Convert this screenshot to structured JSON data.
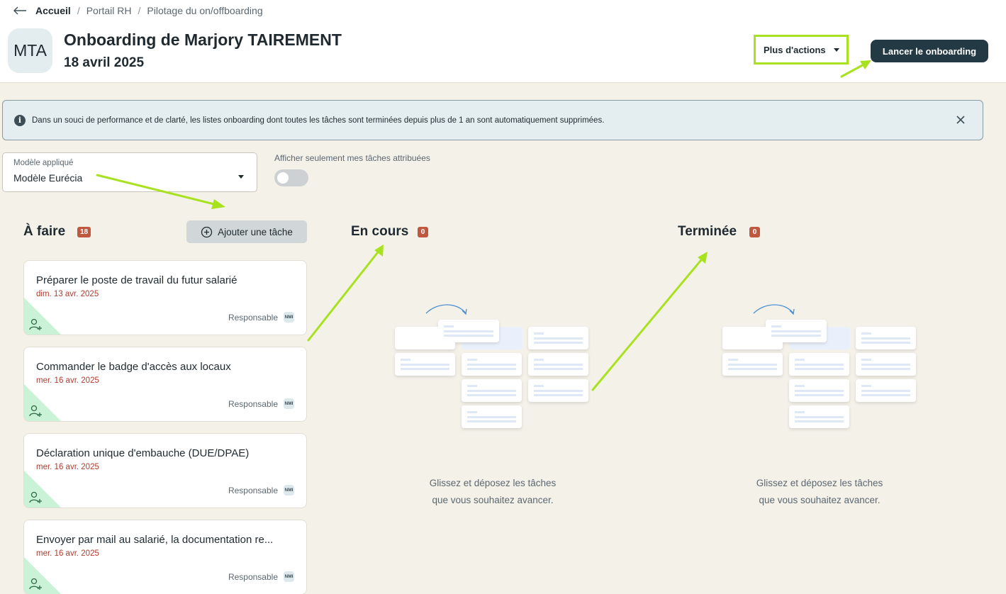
{
  "breadcrumb": {
    "items": [
      "Accueil",
      "Portail RH",
      "Pilotage du on/offboarding"
    ]
  },
  "header": {
    "avatar_initials": "MTA",
    "title": "Onboarding de Marjory TAIREMENT",
    "date": "18 avril 2025",
    "more_actions_label": "Plus d'actions",
    "launch_label": "Lancer le onboarding"
  },
  "banner": {
    "icon": "info-icon",
    "text": "Dans un souci de performance et de clarté, les listes onboarding dont toutes les tâches sont terminées depuis plus de 1 an sont automatiquement supprimées."
  },
  "filters": {
    "model_label": "Modèle appliqué",
    "model_value": "Modèle Eurécia",
    "toggle_label": "Afficher seulement mes tâches attribuées",
    "toggle_on": false
  },
  "columns": {
    "todo": {
      "title": "À faire",
      "count": "18",
      "add_label": "Ajouter une tâche",
      "tasks": [
        {
          "title": "Préparer le poste de travail du futur salarié",
          "date": "dim. 13 avr. 2025",
          "responsable": "Responsable",
          "badge": "NMI"
        },
        {
          "title": "Commander le badge d'accès aux locaux",
          "date": "mer. 16 avr. 2025",
          "responsable": "Responsable",
          "badge": "NMI"
        },
        {
          "title": "Déclaration unique d'embauche (DUE/DPAE)",
          "date": "mer. 16 avr. 2025",
          "responsable": "Responsable",
          "badge": "NMI"
        },
        {
          "title": "Envoyer par mail au salarié, la documentation re...",
          "date": "mer. 16 avr. 2025",
          "responsable": "Responsable",
          "badge": "NMI"
        }
      ]
    },
    "in_progress": {
      "title": "En cours",
      "count": "0",
      "empty_line1": "Glissez et déposez les tâches",
      "empty_line2": "que vous souhaitez avancer."
    },
    "done": {
      "title": "Terminée",
      "count": "0",
      "empty_line1": "Glissez et déposez les tâches",
      "empty_line2": "que vous souhaitez avancer."
    }
  },
  "colors": {
    "primary": "#233a44",
    "highlight": "#a8e21f",
    "badge": "#c0583f",
    "due_date": "#b03a2e",
    "page_bg": "#f4f1e9"
  }
}
